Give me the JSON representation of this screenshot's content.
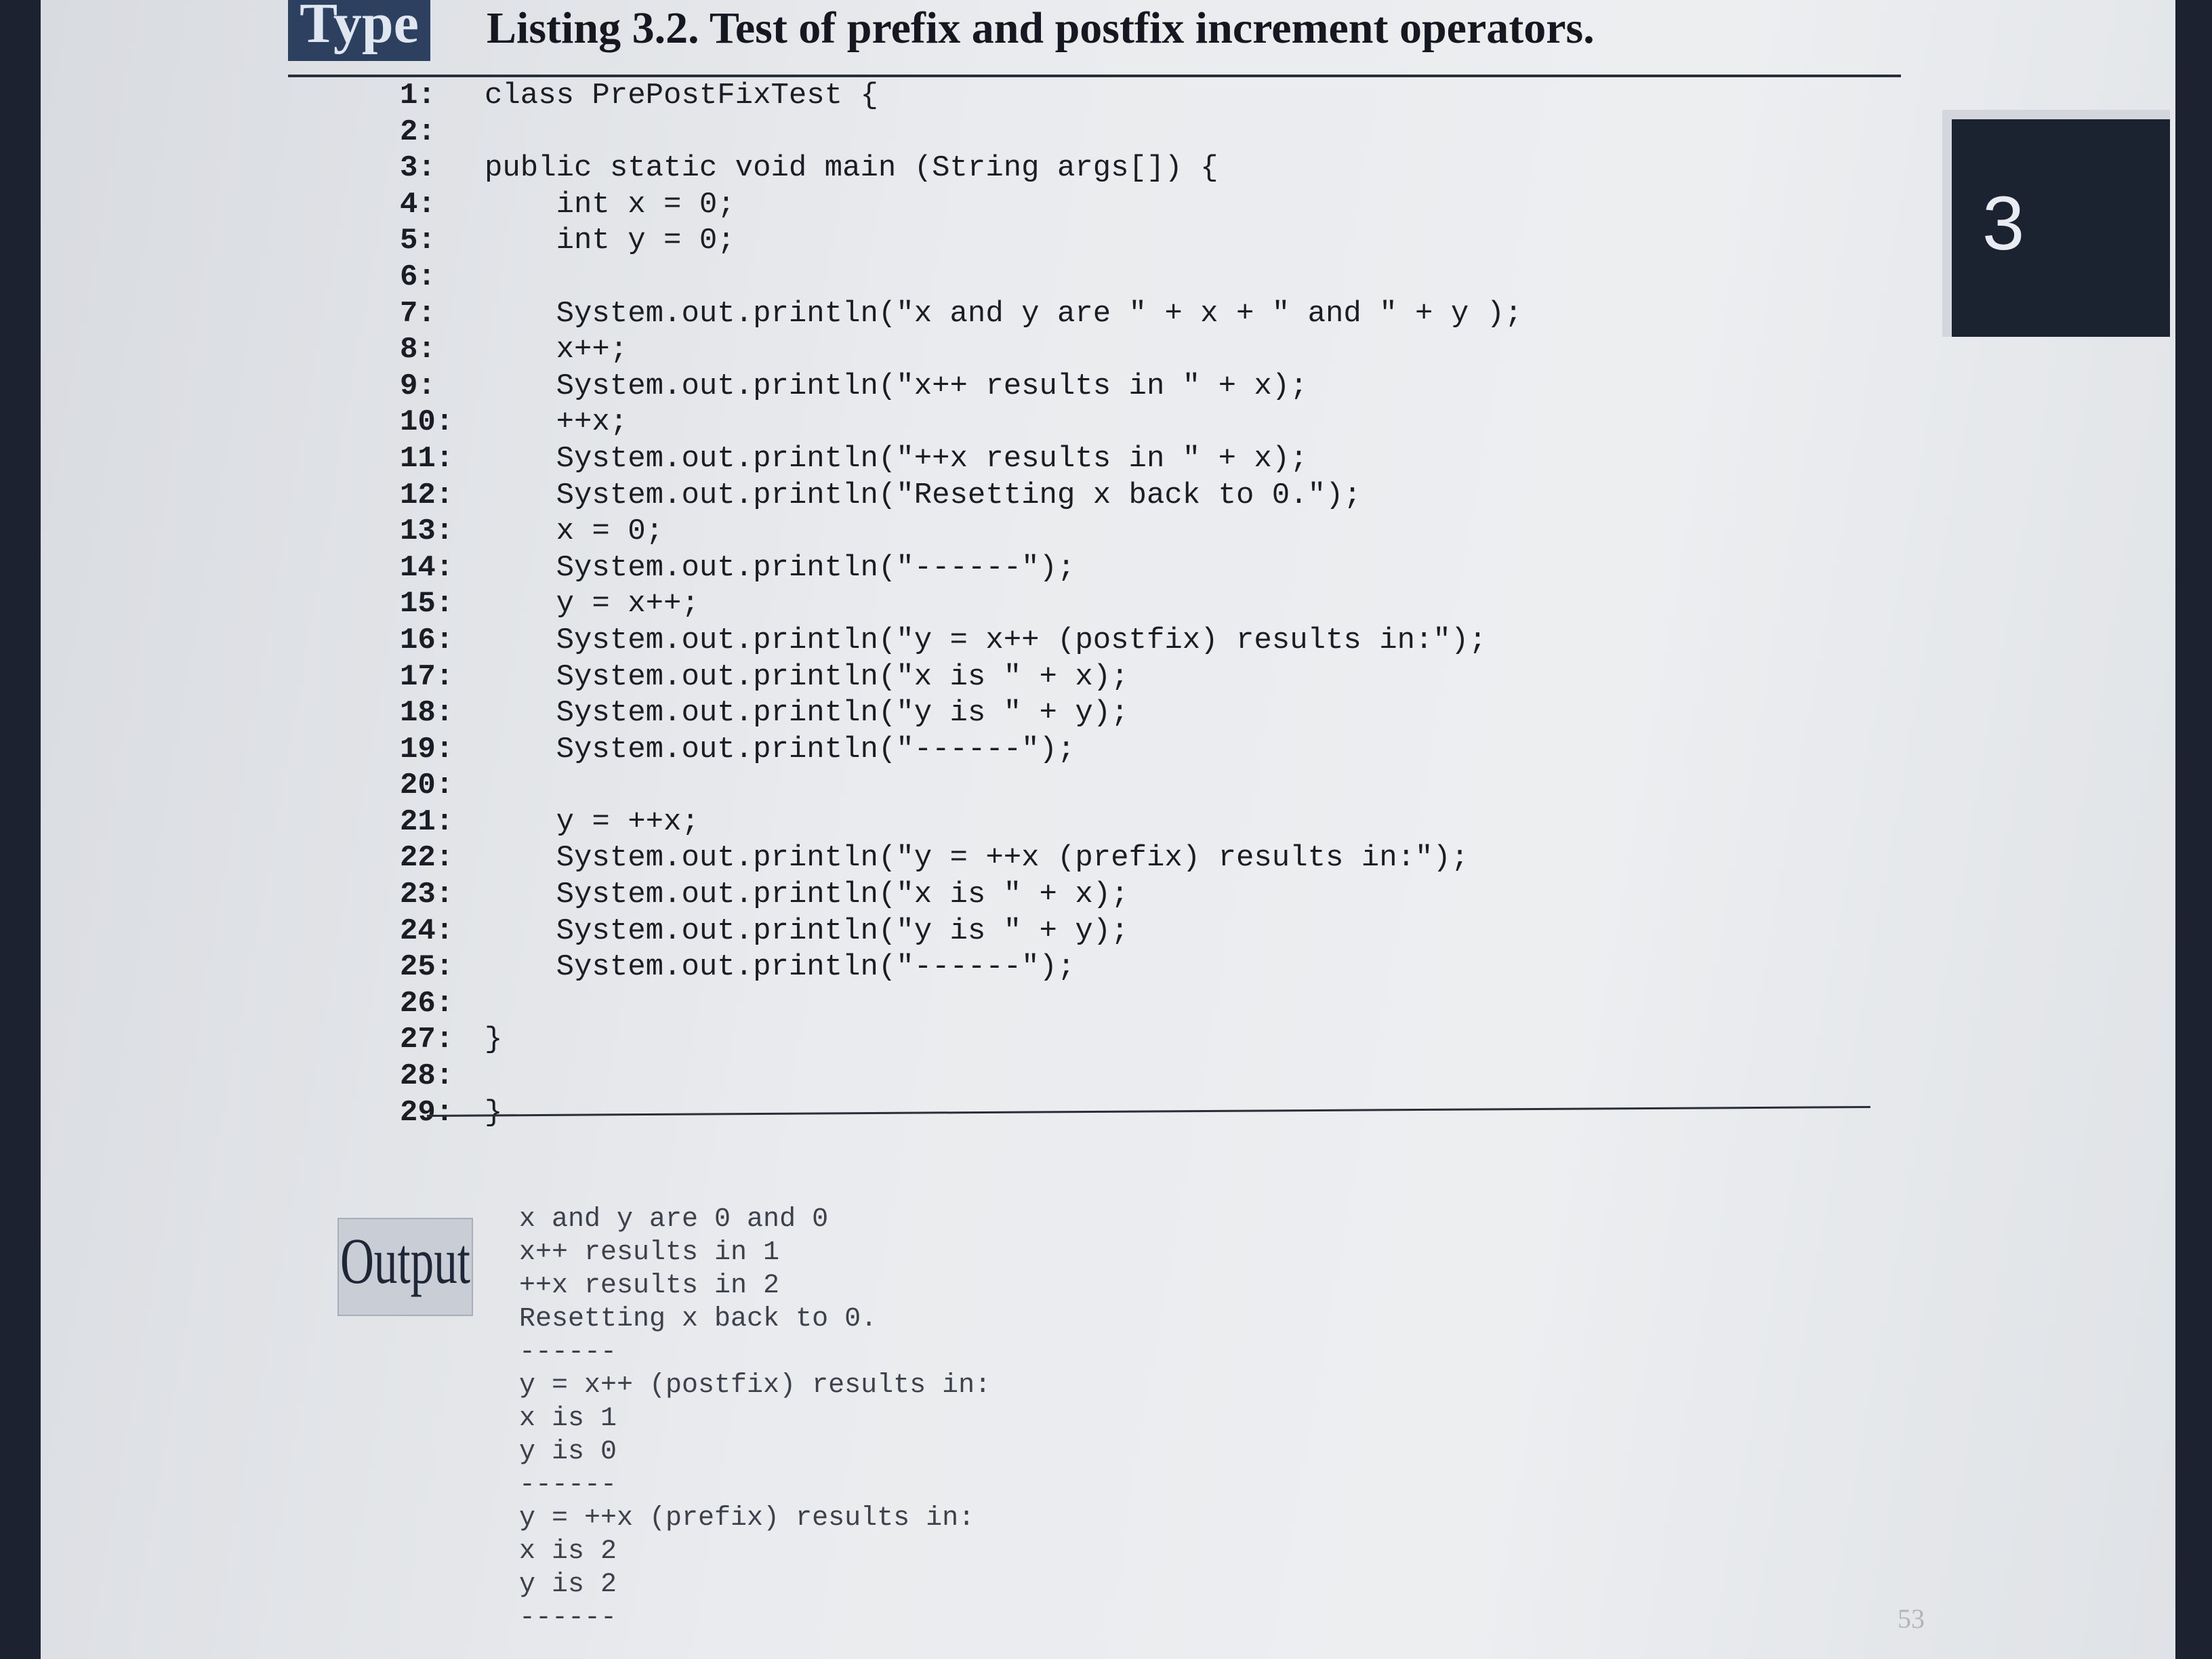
{
  "badge": {
    "label": "Type"
  },
  "listing": {
    "title": "Listing 3.2. Test of prefix and postfix increment operators.",
    "lines": [
      {
        "num": "1:",
        "code": "class PrePostFixTest {"
      },
      {
        "num": "2:",
        "code": ""
      },
      {
        "num": "3:",
        "code": "public static void main (String args[]) {"
      },
      {
        "num": "4:",
        "code": "    int x = 0;"
      },
      {
        "num": "5:",
        "code": "    int y = 0;"
      },
      {
        "num": "6:",
        "code": ""
      },
      {
        "num": "7:",
        "code": "    System.out.println(\"x and y are \" + x + \" and \" + y );"
      },
      {
        "num": "8:",
        "code": "    x++;"
      },
      {
        "num": "9:",
        "code": "    System.out.println(\"x++ results in \" + x);"
      },
      {
        "num": "10:",
        "code": "    ++x;"
      },
      {
        "num": "11:",
        "code": "    System.out.println(\"++x results in \" + x);"
      },
      {
        "num": "12:",
        "code": "    System.out.println(\"Resetting x back to 0.\");"
      },
      {
        "num": "13:",
        "code": "    x = 0;"
      },
      {
        "num": "14:",
        "code": "    System.out.println(\"------\");"
      },
      {
        "num": "15:",
        "code": "    y = x++;"
      },
      {
        "num": "16:",
        "code": "    System.out.println(\"y = x++ (postfix) results in:\");"
      },
      {
        "num": "17:",
        "code": "    System.out.println(\"x is \" + x);"
      },
      {
        "num": "18:",
        "code": "    System.out.println(\"y is \" + y);"
      },
      {
        "num": "19:",
        "code": "    System.out.println(\"------\");"
      },
      {
        "num": "20:",
        "code": ""
      },
      {
        "num": "21:",
        "code": "    y = ++x;"
      },
      {
        "num": "22:",
        "code": "    System.out.println(\"y = ++x (prefix) results in:\");"
      },
      {
        "num": "23:",
        "code": "    System.out.println(\"x is \" + x);"
      },
      {
        "num": "24:",
        "code": "    System.out.println(\"y is \" + y);"
      },
      {
        "num": "25:",
        "code": "    System.out.println(\"------\");"
      },
      {
        "num": "26:",
        "code": ""
      },
      {
        "num": "27:",
        "code": "}"
      },
      {
        "num": "28:",
        "code": ""
      },
      {
        "num": "29:",
        "code": "}"
      }
    ]
  },
  "chapter_tab": {
    "number": "3"
  },
  "output": {
    "label": "Output",
    "lines": [
      "x and y are 0 and 0",
      "x++ results in 1",
      "++x results in 2",
      "Resetting x back to 0.",
      "------",
      "y = x++ (postfix) results in:",
      "x is 1",
      "y is 0",
      "------",
      "y = ++x (prefix) results in:",
      "x is 2",
      "y is 2",
      "------"
    ]
  },
  "page_number": "53"
}
